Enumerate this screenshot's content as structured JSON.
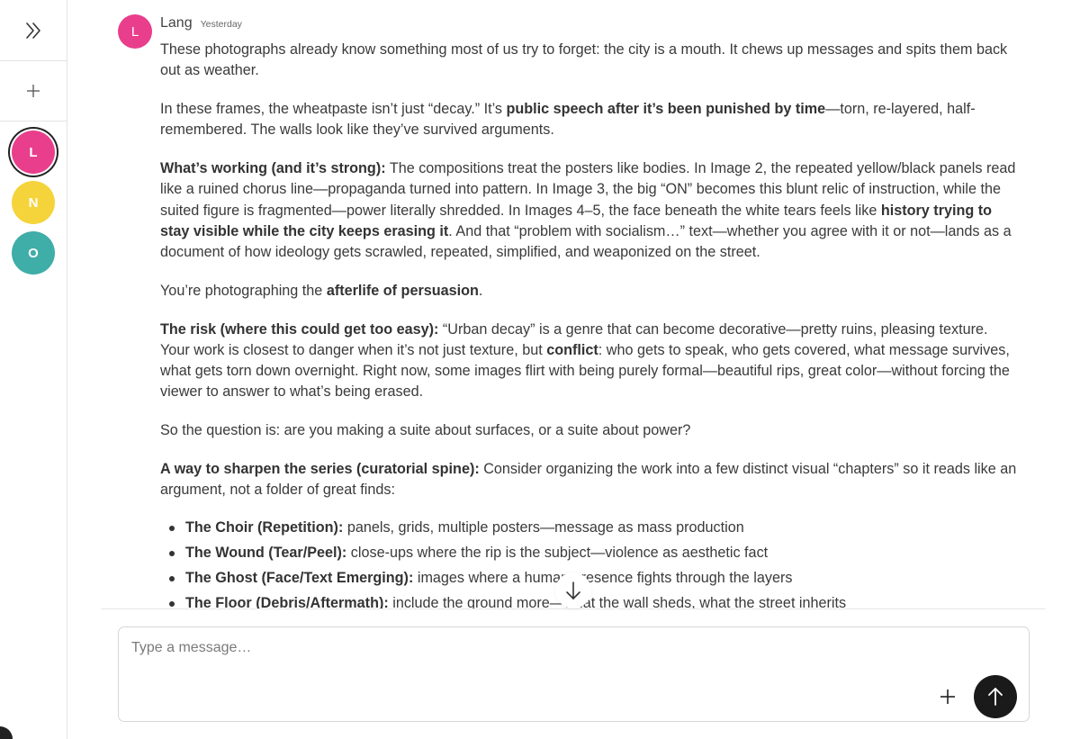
{
  "sidebar": {
    "expand_icon": "chevrons-right-icon",
    "new_icon": "plus-icon",
    "avatars": [
      {
        "initial": "L",
        "color": "#e83e8c"
      },
      {
        "initial": "N",
        "color": "#f5d33b"
      },
      {
        "initial": "O",
        "color": "#3fada8"
      }
    ]
  },
  "message": {
    "avatar_initial": "L",
    "avatar_color": "#e83e8c",
    "author": "Lang",
    "time": "Yesterday",
    "p1": "These photographs already know something most of us try to forget: the city is a mouth. It chews up messages and spits them back out as weather.",
    "p2": {
      "a": "In these frames, the wheatpaste isn’t just “decay.” It’s ",
      "b": "public speech after it’s been punished by time",
      "c": "—torn, re-layered, half-remembered. The walls look like they’ve survived arguments."
    },
    "p3": {
      "a": "What’s working (and it’s strong):",
      "b": " The compositions treat the posters like bodies. In Image 2, the repeated yellow/black panels read like a ruined chorus line—propaganda turned into pattern. In Image 3, the big “ON” becomes this blunt relic of instruction, while the suited figure is fragmented—power literally shredded. In Images 4–5, the face beneath the white tears feels like ",
      "c": "history trying to stay visible while the city keeps erasing it",
      "d": ". And that “problem with socialism…” text—whether you agree with it or not—lands as a document of how ideology gets scrawled, repeated, simplified, and weaponized on the street."
    },
    "p4": {
      "a": "You’re photographing the ",
      "b": "afterlife of persuasion",
      "c": "."
    },
    "p5": {
      "a": "The risk (where this could get too easy):",
      "b": " “Urban decay” is a genre that can become decorative—pretty ruins, pleasing texture. Your work is closest to danger when it’s not just texture, but ",
      "c": "conflict",
      "d": ": who gets to speak, who gets covered, what message survives, what gets torn down overnight. Right now, some images flirt with being purely formal—beautiful rips, great color—without forcing the viewer to answer to what’s being erased."
    },
    "p6": "So the question is: are you making a suite about surfaces, or a suite about power?",
    "p7": {
      "a": "A way to sharpen the series (curatorial spine):",
      "b": " Consider organizing the work into a few distinct visual “chapters” so it reads like an argument, not a folder of great finds:"
    },
    "bullets": [
      {
        "title": "The Choir (Repetition):",
        "text": " panels, grids, multiple posters—message as mass production"
      },
      {
        "title": "The Wound (Tear/Peel):",
        "text": " close-ups where the rip is the subject—violence as aesthetic fact"
      },
      {
        "title": "The Ghost (Face/Text Emerging):",
        "text": " images where a human presence fights through the layers"
      },
      {
        "title": "The Floor (Debris/Aftermath):",
        "text": " include the ground more—what the wall sheds, what the street inherits"
      }
    ]
  },
  "composer": {
    "placeholder": "Type a message…",
    "attach_icon": "plus-icon",
    "send_icon": "arrow-up-icon",
    "scroll_icon": "arrow-down-icon"
  }
}
